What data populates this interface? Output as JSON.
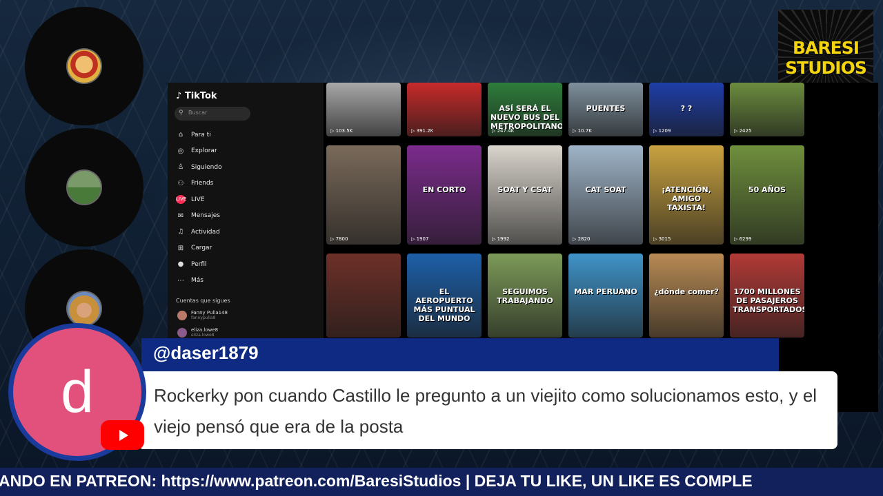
{
  "overlay": {
    "logo_lines": [
      "BARESI",
      "STUDIOS"
    ],
    "ticker_text": "ANDO EN PATREON: https://www.patreon.com/BaresiStudios | DEJA TU LIKE, UN LIKE ES COMPLE"
  },
  "tiktok": {
    "brand": "TikTok",
    "search_placeholder": "Buscar",
    "nav": [
      {
        "label": "Para ti",
        "icon": "home-icon",
        "glyph": "⌂"
      },
      {
        "label": "Explorar",
        "icon": "compass-icon",
        "glyph": "◎"
      },
      {
        "label": "Siguiendo",
        "icon": "user-follow-icon",
        "glyph": "♙"
      },
      {
        "label": "Friends",
        "icon": "friends-icon",
        "glyph": "⚇"
      },
      {
        "label": "LIVE",
        "icon": "live-icon",
        "glyph": "LIVE"
      },
      {
        "label": "Mensajes",
        "icon": "message-icon",
        "glyph": "✉"
      },
      {
        "label": "Actividad",
        "icon": "bell-icon",
        "glyph": "♫"
      },
      {
        "label": "Cargar",
        "icon": "upload-icon",
        "glyph": "⊞"
      },
      {
        "label": "Perfil",
        "icon": "profile-icon",
        "glyph": "●"
      },
      {
        "label": "Más",
        "icon": "more-icon",
        "glyph": "⋯"
      }
    ],
    "following_title": "Cuentas que sigues",
    "following": [
      {
        "name": "Fanny Pulla148",
        "handle": "fannypulla8"
      },
      {
        "name": "eliza.lowe8",
        "handle": "eliza.lowe8"
      }
    ],
    "tiles": [
      {
        "count": "103.5K",
        "text": "",
        "color": "#a8a8a8"
      },
      {
        "count": "391.2K",
        "text": "",
        "color": "#c72a2a"
      },
      {
        "count": "247.4K",
        "text": "ASÍ SERÁ EL NUEVO BUS DEL METROPOLITANO",
        "color": "#2e7d3b"
      },
      {
        "count": "10.7K",
        "text": "PUENTES",
        "color": "#7e8f9c"
      },
      {
        "count": "1209",
        "text": "? ?",
        "color": "#1e3ea8"
      },
      {
        "count": "2425",
        "text": "",
        "color": "#6c8c3e"
      },
      {
        "count": "7800",
        "text": "",
        "color": "#7a6a5a"
      },
      {
        "count": "1907",
        "text": "EN CORTO",
        "color": "#7b2b8c"
      },
      {
        "count": "1992",
        "text": "SOAT Y CSAT",
        "color": "#d9d4cc"
      },
      {
        "count": "2820",
        "text": "CAT SOAT",
        "color": "#9fb4c8"
      },
      {
        "count": "3015",
        "text": "¡ATENCIÓN, AMIGO TAXISTA!",
        "color": "#c9a240"
      },
      {
        "count": "6299",
        "text": "50 AÑOS",
        "color": "#6f8f3c"
      },
      {
        "count": "",
        "text": "",
        "color": "#6d3028"
      },
      {
        "count": "",
        "text": "EL AEROPUERTO MÁS PUNTUAL DEL MUNDO",
        "color": "#1d5fa8"
      },
      {
        "count": "",
        "text": "SEGUIMOS TRABAJANDO",
        "color": "#7c9a58"
      },
      {
        "count": "",
        "text": "MAR PERUANO",
        "color": "#3f93c9"
      },
      {
        "count": "",
        "text": "¿dónde comer?",
        "color": "#b88a54"
      },
      {
        "count": "",
        "text": "1700 MILLONES DE PASAJEROS TRANSPORTADOS",
        "color": "#b13a36"
      }
    ]
  },
  "chat": {
    "username": "@daser1879",
    "avatar_letter": "d",
    "message": "Rockerky pon cuando Castillo le pregunto a un viejito como solucionamos esto, y el viejo pensó que era de la posta"
  },
  "colors": {
    "chat_avatar": "#e2517b",
    "chat_bar": "#0e2a82",
    "ticker_bg": "#12215c",
    "logo_text": "#f4d40c",
    "youtube_red": "#ff0000"
  }
}
